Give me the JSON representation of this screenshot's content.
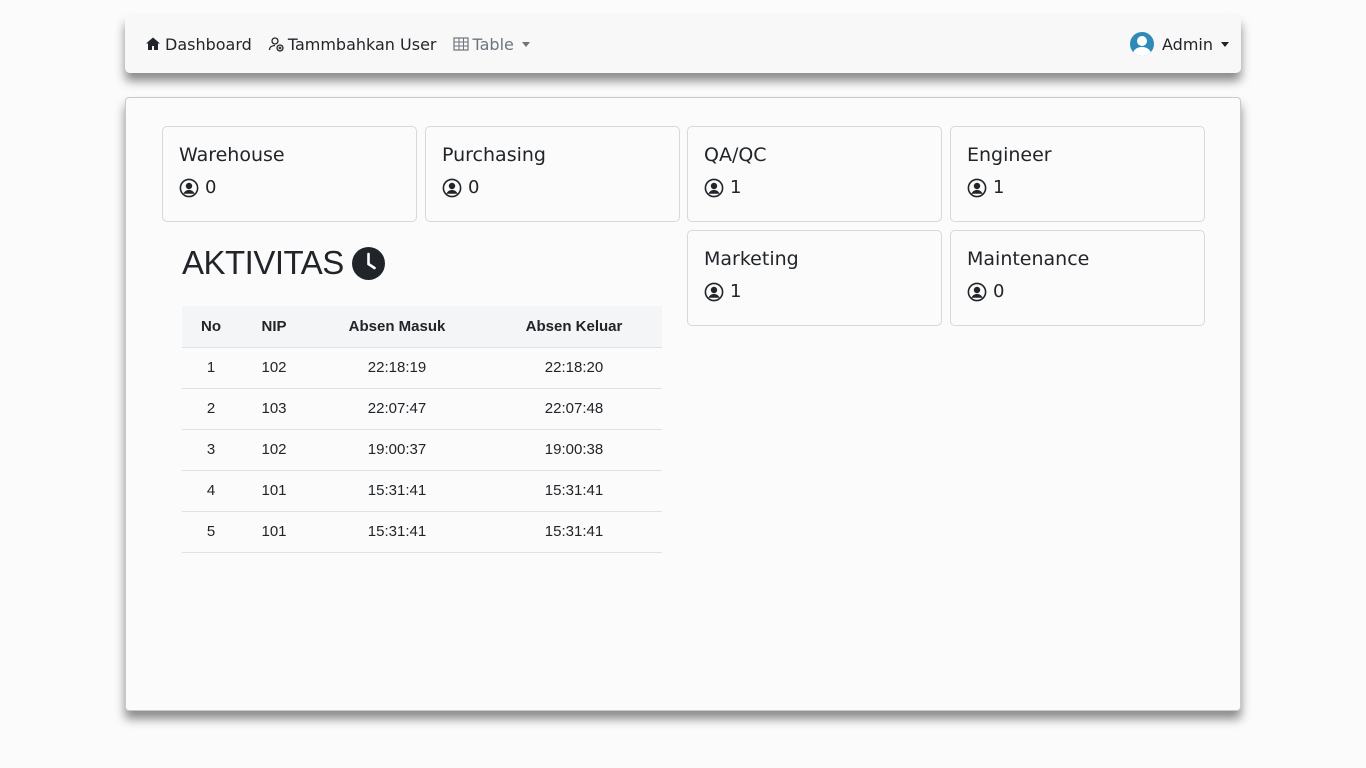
{
  "nav": {
    "dashboard": "Dashboard",
    "add_user": "Tammbahkan User",
    "table": "Table",
    "user": "Admin"
  },
  "departments": [
    {
      "name": "Warehouse",
      "count": "0"
    },
    {
      "name": "Purchasing",
      "count": "0"
    },
    {
      "name": "QA/QC",
      "count": "1"
    },
    {
      "name": "Engineer",
      "count": "1"
    },
    {
      "name": "Marketing",
      "count": "1"
    },
    {
      "name": "Maintenance",
      "count": "0"
    }
  ],
  "activity": {
    "title": "AKTIVITAS",
    "headers": [
      "No",
      "NIP",
      "Absen Masuk",
      "Absen Keluar"
    ],
    "rows": [
      [
        "1",
        "102",
        "22:18:19",
        "22:18:20"
      ],
      [
        "2",
        "103",
        "22:07:47",
        "22:07:48"
      ],
      [
        "3",
        "102",
        "19:00:37",
        "19:00:38"
      ],
      [
        "4",
        "101",
        "15:31:41",
        "15:31:41"
      ],
      [
        "5",
        "101",
        "15:31:41",
        "15:31:41"
      ]
    ]
  },
  "colors": {
    "accent": "#2f8ab8",
    "text": "#212529"
  }
}
